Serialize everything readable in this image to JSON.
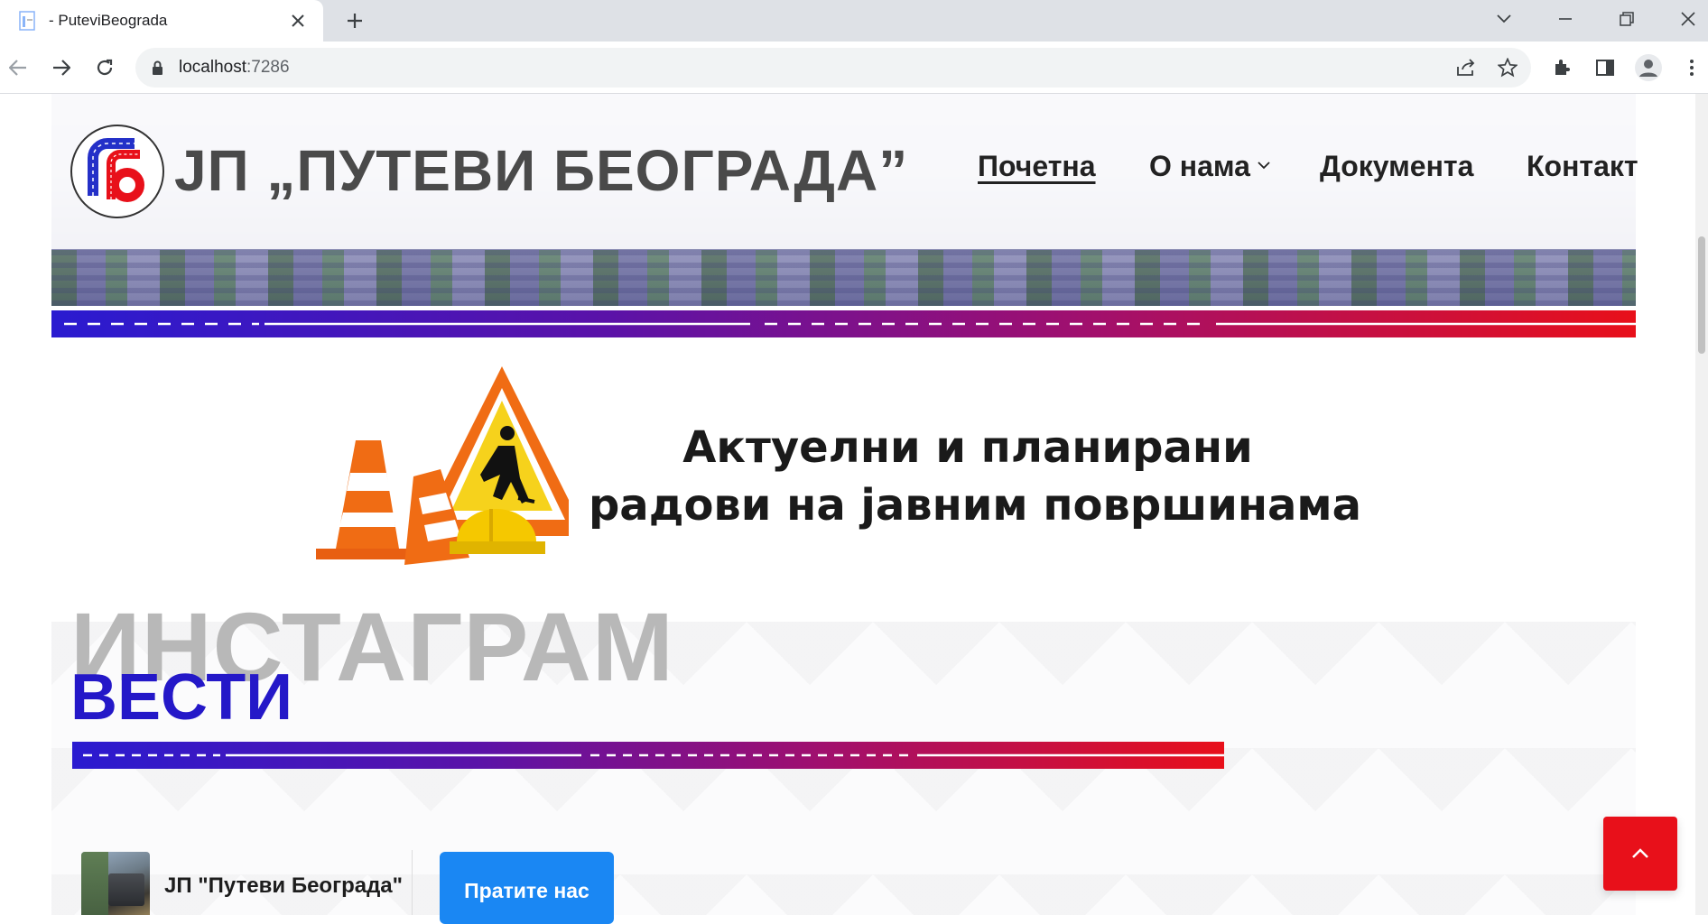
{
  "browser": {
    "tab_title": "- PuteviBeograda",
    "url_host": "localhost",
    "url_port": ":7286"
  },
  "header": {
    "brand": "ЈП „ПУТЕВИ БЕОГРАДА”",
    "menu": [
      {
        "label": "Почетна"
      },
      {
        "label": "О нама"
      },
      {
        "label": "Документа"
      },
      {
        "label": "Контакт"
      }
    ]
  },
  "works_banner": {
    "line1": "Актуелни и планирани",
    "line2": "радови на јавним површинама"
  },
  "instagram": {
    "title": "ИНСТАГРАМ",
    "subtitle": "ВЕСТИ",
    "profile_name": "ЈП \"Путеви Београда\"",
    "follow_label": "Пратите нас"
  },
  "colors": {
    "accent_red": "#e8101a",
    "accent_blue": "#2418c8",
    "follow_blue": "#1a87f3"
  }
}
